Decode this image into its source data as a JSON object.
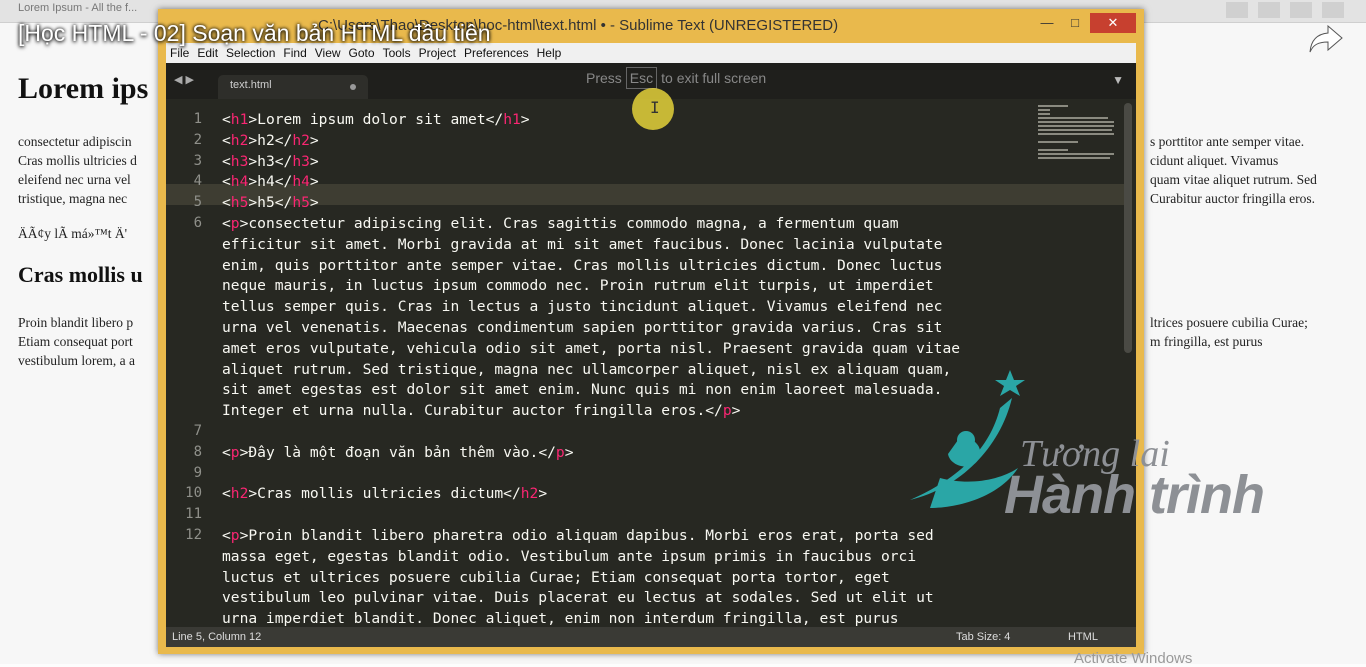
{
  "browser": {
    "tab_title": "Lorem Ipsum - All the f..."
  },
  "video": {
    "title": "[Học HTML - 02] Soạn văn bản HTML đầu tiên"
  },
  "background_page": {
    "h1": "Lorem ips",
    "p1_left": [
      "consectetur adipiscin",
      "Cras mollis ultricies d",
      "eleifend nec urna vel",
      "tristique, magna nec"
    ],
    "p1_right": [
      "s porttitor ante semper vitae.",
      "cidunt aliquet. Vivamus",
      "quam vitae aliquet rutrum. Sed",
      "Curabitur auctor fringilla eros."
    ],
    "p2": "ÄÃ¢y lÃ  má»™t Ä'",
    "h2": "Cras mollis u",
    "p3_left": [
      "Proin blandit libero p",
      "Etiam consequat port",
      "vestibulum lorem, a a"
    ],
    "p3_right": [
      "ltrices posuere cubilia Curae;",
      "m fringilla, est purus"
    ]
  },
  "windows_watermark": "Activate Windows",
  "sublime": {
    "title": "C:\\Users\\Thao\\Desktop\\hoc-html\\text.html • - Sublime Text (UNREGISTERED)",
    "window_buttons": [
      "—",
      "□",
      "✕"
    ],
    "menu": [
      "File",
      "Edit",
      "Selection",
      "Find",
      "View",
      "Goto",
      "Tools",
      "Project",
      "Preferences",
      "Help"
    ],
    "fullscreen_hint": {
      "pre": "Press",
      "key": "Esc",
      "post": "to exit full screen"
    },
    "tab_label": "text.html",
    "line_numbers": [
      "1",
      "2",
      "3",
      "4",
      "5",
      "6",
      "7",
      "8",
      "9",
      "10",
      "11",
      "12"
    ],
    "status": {
      "position": "Line 5, Column 12",
      "tab_size": "Tab Size: 4",
      "syntax": "HTML"
    }
  },
  "code_lines": [
    {
      "ln": "1",
      "parts": [
        [
          "t",
          "<"
        ],
        [
          "g",
          "h1"
        ],
        [
          "t",
          ">Lorem ipsum dolor sit amet</"
        ],
        [
          "g",
          "h1"
        ],
        [
          "t",
          ">"
        ]
      ]
    },
    {
      "ln": "2",
      "parts": [
        [
          "t",
          "<"
        ],
        [
          "g",
          "h2"
        ],
        [
          "t",
          ">h2</"
        ],
        [
          "g",
          "h2"
        ],
        [
          "t",
          ">"
        ]
      ]
    },
    {
      "ln": "3",
      "parts": [
        [
          "t",
          "<"
        ],
        [
          "g",
          "h3"
        ],
        [
          "t",
          ">h3</"
        ],
        [
          "g",
          "h3"
        ],
        [
          "t",
          ">"
        ]
      ]
    },
    {
      "ln": "4",
      "parts": [
        [
          "t",
          "<"
        ],
        [
          "g",
          "h4"
        ],
        [
          "t",
          ">h4</"
        ],
        [
          "g",
          "h4"
        ],
        [
          "t",
          ">"
        ]
      ]
    },
    {
      "ln": "5",
      "parts": [
        [
          "t",
          "<"
        ],
        [
          "g",
          "h5"
        ],
        [
          "t",
          ">h5</"
        ],
        [
          "g",
          "h5"
        ],
        [
          "t",
          ">"
        ]
      ]
    },
    {
      "ln": "6",
      "parts": [
        [
          "t",
          "<"
        ],
        [
          "g",
          "p"
        ],
        [
          "t",
          ">consectetur adipiscing elit. Cras sagittis commodo magna, a fermentum quam"
        ]
      ]
    },
    {
      "ln": "",
      "parts": [
        [
          "t",
          "efficitur sit amet. Morbi gravida at mi sit amet faucibus. Donec lacinia vulputate"
        ]
      ]
    },
    {
      "ln": "",
      "parts": [
        [
          "t",
          "enim, quis porttitor ante semper vitae. Cras mollis ultricies dictum. Donec luctus"
        ]
      ]
    },
    {
      "ln": "",
      "parts": [
        [
          "t",
          "neque mauris, in luctus ipsum commodo nec. Proin rutrum elit turpis, ut imperdiet"
        ]
      ]
    },
    {
      "ln": "",
      "parts": [
        [
          "t",
          "tellus semper quis. Cras in lectus a justo tincidunt aliquet. Vivamus eleifend nec"
        ]
      ]
    },
    {
      "ln": "",
      "parts": [
        [
          "t",
          "urna vel venenatis. Maecenas condimentum sapien porttitor gravida varius. Cras sit"
        ]
      ]
    },
    {
      "ln": "",
      "parts": [
        [
          "t",
          "amet eros vulputate, vehicula odio sit amet, porta nisl. Praesent gravida quam vitae"
        ]
      ]
    },
    {
      "ln": "",
      "parts": [
        [
          "t",
          "aliquet rutrum. Sed tristique, magna nec ullamcorper aliquet, nisl ex aliquam quam,"
        ]
      ]
    },
    {
      "ln": "",
      "parts": [
        [
          "t",
          "sit amet egestas est dolor sit amet enim. Nunc quis mi non enim laoreet malesuada."
        ]
      ]
    },
    {
      "ln": "",
      "parts": [
        [
          "t",
          "Integer et urna nulla. Curabitur auctor fringilla eros.</"
        ],
        [
          "g",
          "p"
        ],
        [
          "t",
          ">"
        ]
      ]
    },
    {
      "ln": "7",
      "parts": []
    },
    {
      "ln": "8",
      "parts": [
        [
          "t",
          "<"
        ],
        [
          "g",
          "p"
        ],
        [
          "t",
          ">Đây là một đoạn văn bản thêm vào.</"
        ],
        [
          "g",
          "p"
        ],
        [
          "t",
          ">"
        ]
      ]
    },
    {
      "ln": "9",
      "parts": []
    },
    {
      "ln": "10",
      "parts": [
        [
          "t",
          "<"
        ],
        [
          "g",
          "h2"
        ],
        [
          "t",
          ">Cras mollis ultricies dictum</"
        ],
        [
          "g",
          "h2"
        ],
        [
          "t",
          ">"
        ]
      ]
    },
    {
      "ln": "11",
      "parts": []
    },
    {
      "ln": "12",
      "parts": [
        [
          "t",
          "<"
        ],
        [
          "g",
          "p"
        ],
        [
          "t",
          ">Proin blandit libero pharetra odio aliquam dapibus. Morbi eros erat, porta sed"
        ]
      ]
    },
    {
      "ln": "",
      "parts": [
        [
          "t",
          "massa eget, egestas blandit odio. Vestibulum ante ipsum primis in faucibus orci"
        ]
      ]
    },
    {
      "ln": "",
      "parts": [
        [
          "t",
          "luctus et ultrices posuere cubilia Curae; Etiam consequat porta tortor, eget"
        ]
      ]
    },
    {
      "ln": "",
      "parts": [
        [
          "t",
          "vestibulum leo pulvinar vitae. Duis placerat eu lectus at sodales. Sed ut elit ut"
        ]
      ]
    },
    {
      "ln": "",
      "parts": [
        [
          "t",
          "urna imperdiet blandit. Donec aliquet, enim non interdum fringilla, est purus"
        ]
      ]
    }
  ],
  "logo": {
    "line1": "Tương lai",
    "line2": "Hành trình"
  },
  "colors": {
    "tag": "#f92672",
    "text": "#f8f8f2",
    "editor_bg": "#272822",
    "frame": "#e9b94c",
    "logo_teal": "#2aa6a6"
  }
}
